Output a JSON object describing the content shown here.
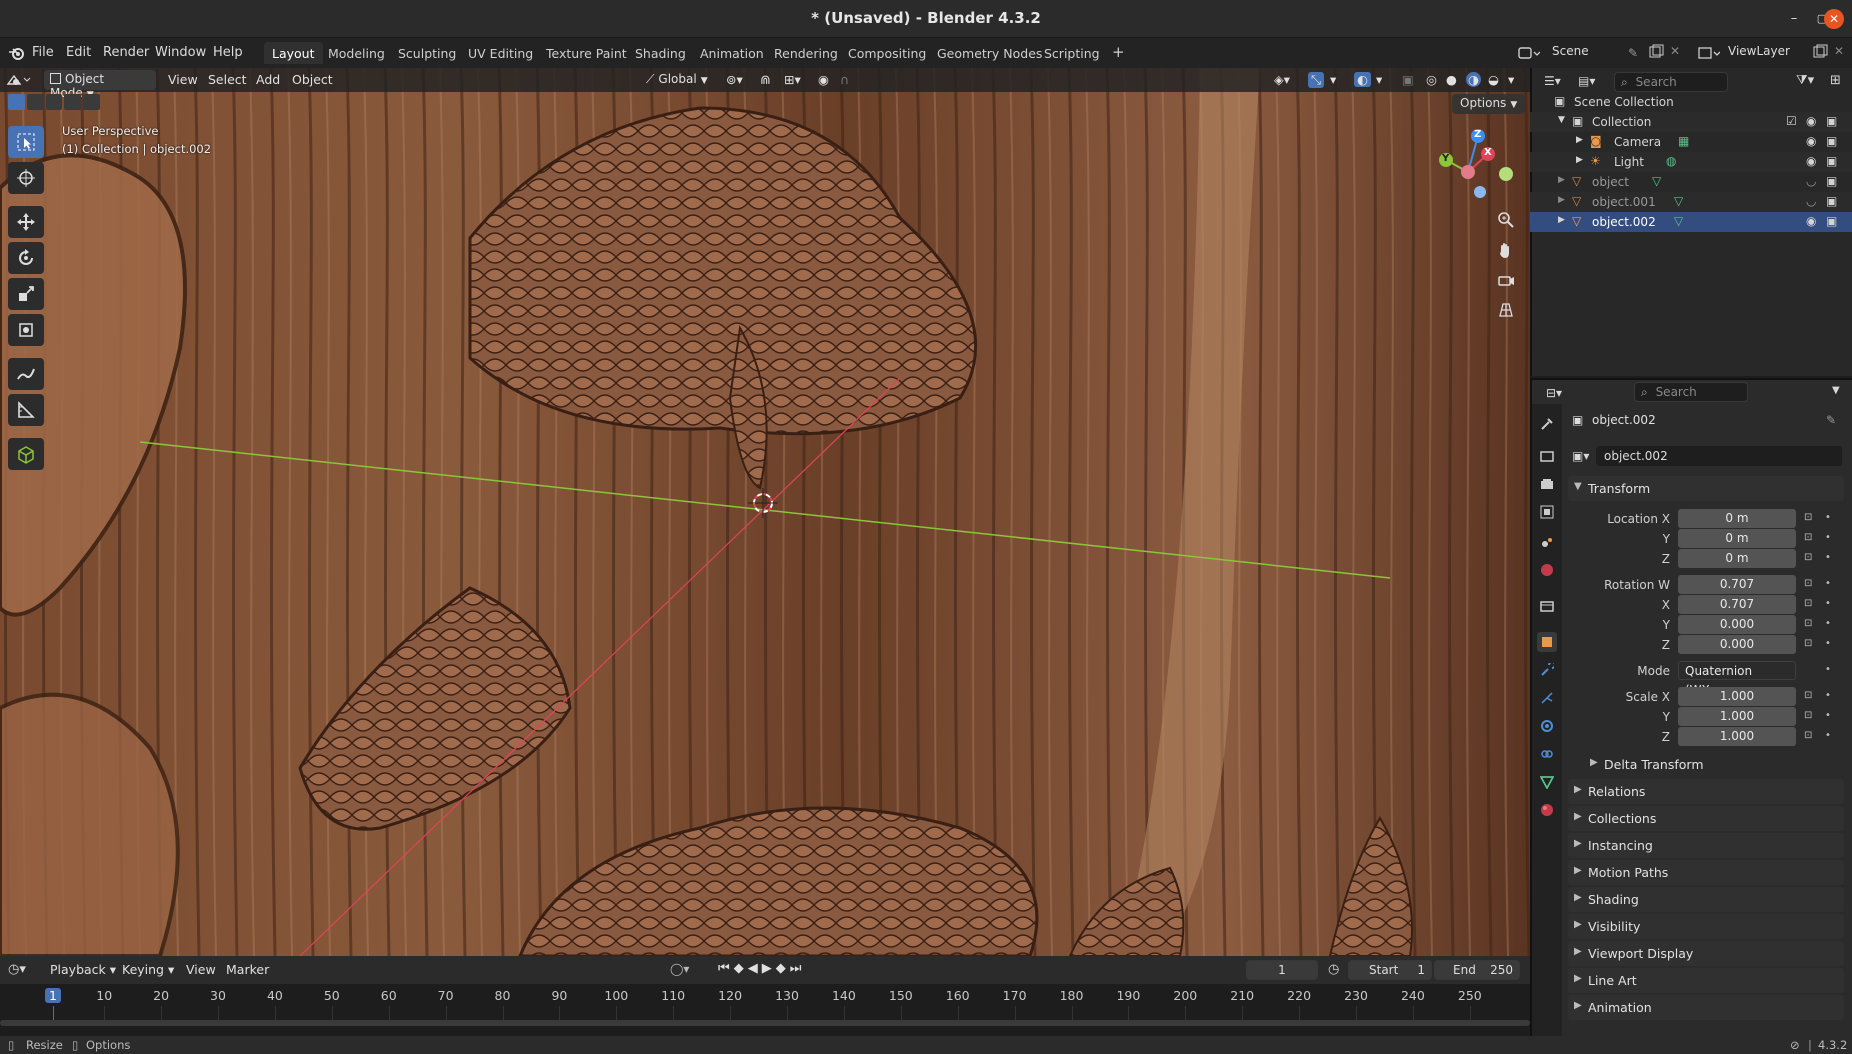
{
  "window": {
    "title": "* (Unsaved) - Blender 4.3.2",
    "minimize_label": "–",
    "maximize_label": "▢",
    "close_label": "✕"
  },
  "menu": {
    "items": [
      "File",
      "Edit",
      "Render",
      "Window",
      "Help"
    ]
  },
  "workspaces": [
    "Layout",
    "Modeling",
    "Sculpting",
    "UV Editing",
    "Texture Paint",
    "Shading",
    "Animation",
    "Rendering",
    "Compositing",
    "Geometry Nodes",
    "Scripting"
  ],
  "workspace_add": "+",
  "scene_field": "Scene",
  "viewlayer_field": "ViewLayer",
  "viewport": {
    "mode": "Object Mode",
    "menus": [
      "View",
      "Select",
      "Add",
      "Object"
    ],
    "orientation": "Global",
    "options_label": "Options",
    "overlay_title": "User Perspective",
    "overlay_subtitle": "(1) Collection | object.002",
    "gizmo_axes": {
      "x": "X",
      "y": "Y",
      "z": "Z"
    }
  },
  "outliner": {
    "search_placeholder": "Search",
    "rows": [
      {
        "label": "Scene Collection"
      },
      {
        "label": "Collection"
      },
      {
        "label": "Camera"
      },
      {
        "label": "Light"
      },
      {
        "label": "object"
      },
      {
        "label": "object.001"
      },
      {
        "label": "object.002"
      }
    ]
  },
  "properties": {
    "search_placeholder": "Search",
    "object_name": "object.002",
    "data_name": "object.002",
    "transform_header": "Transform",
    "location": {
      "label_x": "Location X",
      "label_y": "Y",
      "label_z": "Z",
      "x": "0 m",
      "y": "0 m",
      "z": "0 m"
    },
    "rotation": {
      "label_w": "Rotation W",
      "label_x": "X",
      "label_y": "Y",
      "label_z": "Z",
      "w": "0.707",
      "x": "0.707",
      "y": "0.000",
      "z": "0.000"
    },
    "mode_label": "Mode",
    "mode_value": "Quaternion (WX...",
    "scale": {
      "label_x": "Scale X",
      "label_y": "Y",
      "label_z": "Z",
      "x": "1.000",
      "y": "1.000",
      "z": "1.000"
    },
    "delta_transform": "Delta Transform",
    "panels": [
      "Relations",
      "Collections",
      "Instancing",
      "Motion Paths",
      "Shading",
      "Visibility",
      "Viewport Display",
      "Line Art",
      "Animation"
    ]
  },
  "timeline": {
    "menus": [
      "Playback",
      "Keying",
      "View",
      "Marker"
    ],
    "current_frame": "1",
    "start_label": "Start",
    "start_value": "1",
    "end_label": "End",
    "end_value": "250",
    "ruler": [
      "1",
      "10",
      "20",
      "30",
      "40",
      "50",
      "60",
      "70",
      "80",
      "90",
      "100",
      "110",
      "120",
      "130",
      "140",
      "150",
      "160",
      "170",
      "180",
      "190",
      "200",
      "210",
      "220",
      "230",
      "240",
      "250"
    ]
  },
  "statusbar": {
    "left1": "Resize",
    "left2": "Options",
    "version": "4.3.2"
  },
  "colors": {
    "accent": "#4772b3",
    "selection": "#334d80",
    "x_axis": "#e0435a",
    "y_axis": "#8cc43c",
    "z_axis": "#3d8ef0",
    "close_button": "#e95420"
  }
}
